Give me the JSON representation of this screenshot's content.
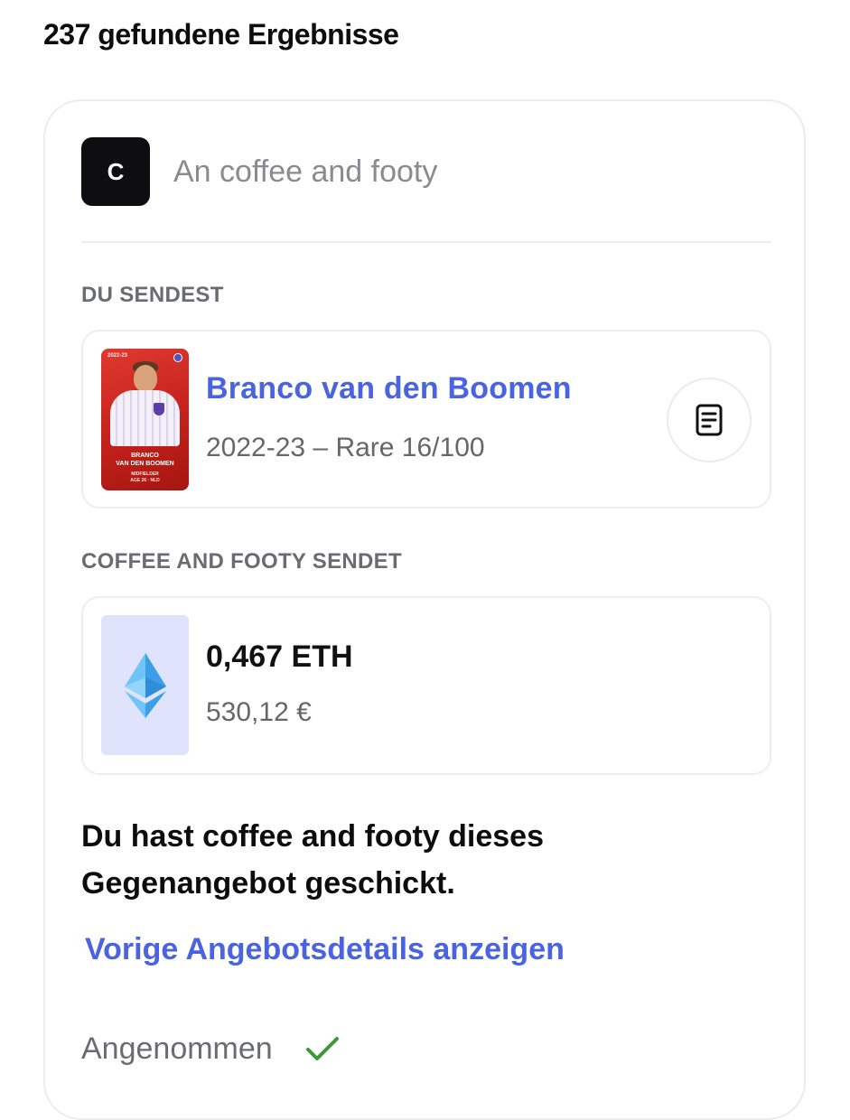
{
  "results": {
    "count_text": "237 gefundene Ergebnisse"
  },
  "counterparty": {
    "avatar_letter": "C",
    "name": "An coffee and footy"
  },
  "you_send": {
    "label": "DU SENDEST",
    "card": {
      "player_name": "Branco van den Boomen",
      "meta": "2022-23 – Rare 16/100",
      "thumb_season": "2022-23",
      "thumb_name_line1": "BRANCO",
      "thumb_name_line2": "VAN DEN BOOMEN",
      "thumb_position": "MIDFIELDER",
      "thumb_age": "AGE 26 · NLD",
      "details_icon": "document-icon"
    }
  },
  "they_send": {
    "label": "COFFEE AND FOOTY SENDET",
    "eth": {
      "amount": "0,467 ETH",
      "fiat": "530,12 €",
      "icon": "ethereum-icon"
    }
  },
  "message": {
    "text": "Du hast coffee and footy dieses Gegenangebot geschickt."
  },
  "link": {
    "prev_details": "Vorige Angebotsdetails anzeigen"
  },
  "status": {
    "label": "Angenommen",
    "icon": "check-icon",
    "icon_color": "#3a9a3a"
  },
  "colors": {
    "accent": "#4a63e0",
    "card_rare": "#c4211c",
    "eth_bg": "#dfe3fb"
  }
}
